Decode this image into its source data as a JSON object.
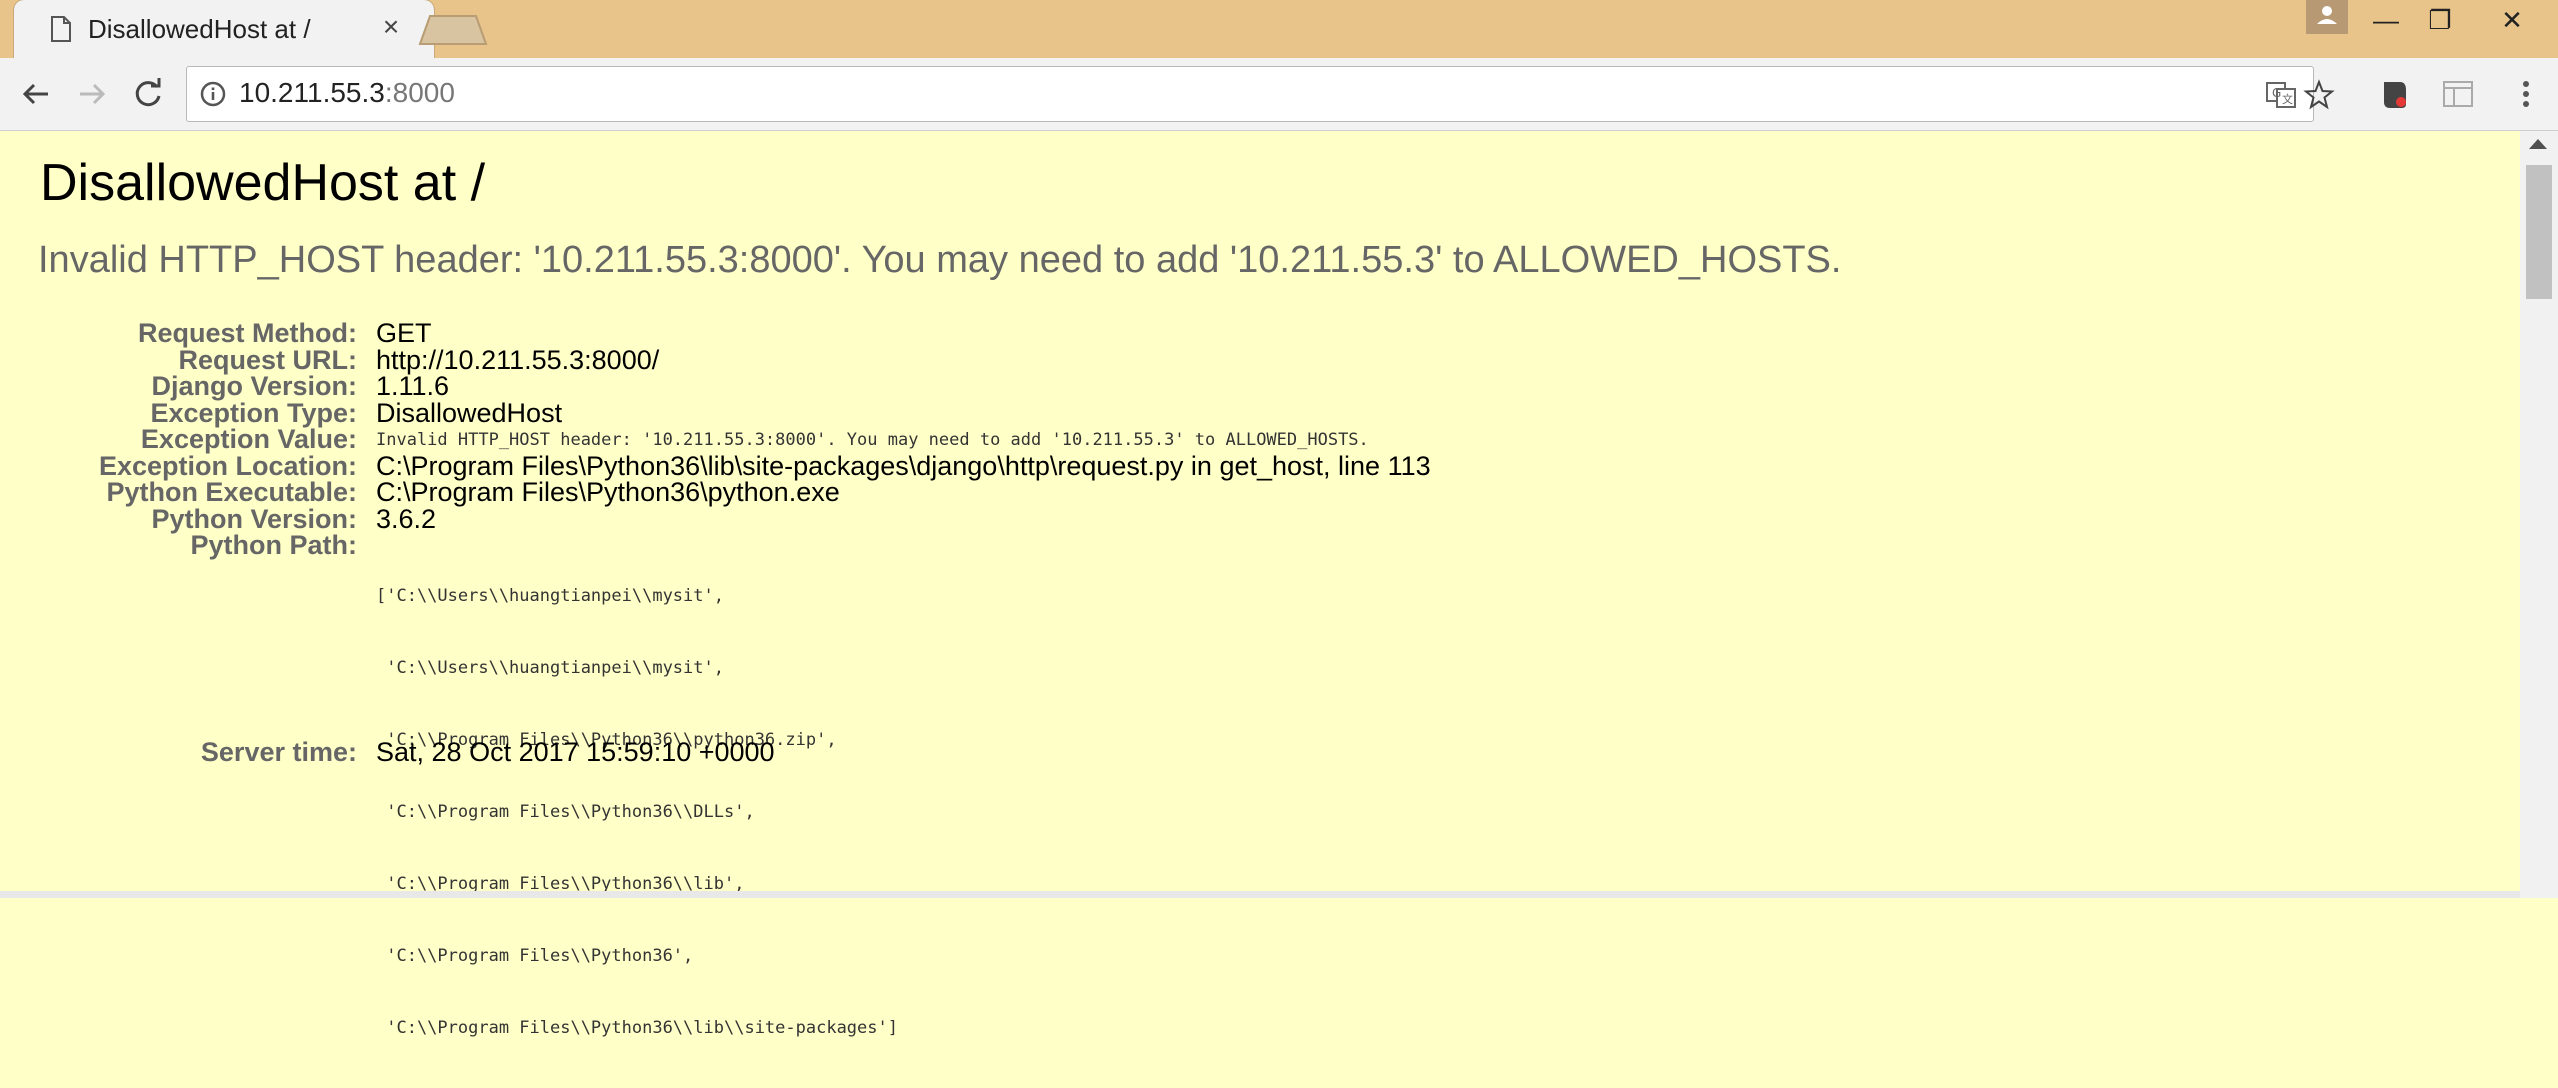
{
  "browser": {
    "tab_title": "DisallowedHost at /",
    "tab_close": "×",
    "url_host": "10.211.55.3",
    "url_port": ":8000"
  },
  "window_controls": {
    "minimize": "—",
    "restore": "❐",
    "close": "✕"
  },
  "page": {
    "title": "DisallowedHost at /",
    "exception_message": "Invalid HTTP_HOST header: '10.211.55.3:8000'. You may need to add '10.211.55.3' to ALLOWED_HOSTS.",
    "meta": [
      {
        "key": "Request Method:",
        "value": "GET"
      },
      {
        "key": "Request URL:",
        "value": "http://10.211.55.3:8000/"
      },
      {
        "key": "Django Version:",
        "value": "1.11.6"
      },
      {
        "key": "Exception Type:",
        "value": "DisallowedHost"
      },
      {
        "key": "Exception Value:",
        "value": "Invalid HTTP_HOST header: '10.211.55.3:8000'. You may need to add '10.211.55.3' to ALLOWED_HOSTS."
      },
      {
        "key": "Exception Location:",
        "value": "C:\\Program Files\\Python36\\lib\\site-packages\\django\\http\\request.py in get_host, line 113"
      },
      {
        "key": "Python Executable:",
        "value": "C:\\Program Files\\Python36\\python.exe"
      },
      {
        "key": "Python Version:",
        "value": "3.6.2"
      },
      {
        "key": "Python Path:",
        "value": ""
      },
      {
        "key": "Server time:",
        "value": "Sat, 28 Oct 2017 15:59:10 +0000"
      }
    ],
    "python_path": [
      "['C:\\\\Users\\\\huangtianpei\\\\mysit',",
      " 'C:\\\\Users\\\\huangtianpei\\\\mysit',",
      " 'C:\\\\Program Files\\\\Python36\\\\python36.zip',",
      " 'C:\\\\Program Files\\\\Python36\\\\DLLs',",
      " 'C:\\\\Program Files\\\\Python36\\\\lib',",
      " 'C:\\\\Program Files\\\\Python36',",
      " 'C:\\\\Program Files\\\\Python36\\\\lib\\\\site-packages']"
    ]
  }
}
